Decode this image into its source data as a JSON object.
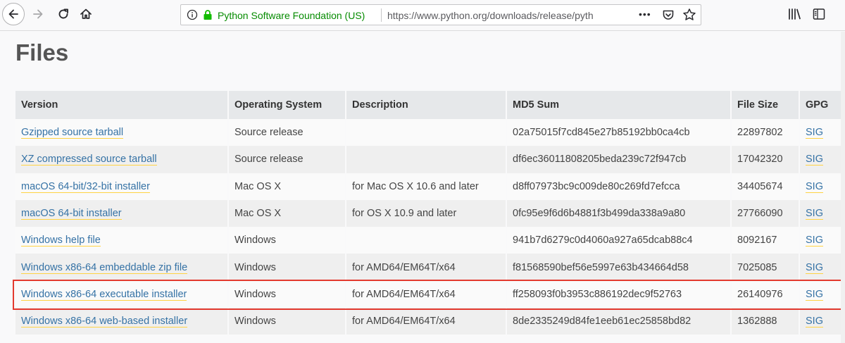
{
  "browser": {
    "site_identity": "Python Software Foundation (US)",
    "url": "https://www.python.org/downloads/release/pyth",
    "more_actions": "•••",
    "colors": {
      "secure_green": "#058b00",
      "url_gray": "#5a5a5e"
    }
  },
  "page": {
    "title": "Files",
    "table": {
      "headers": [
        "Version",
        "Operating System",
        "Description",
        "MD5 Sum",
        "File Size",
        "GPG"
      ],
      "rows": [
        {
          "version": "Gzipped source tarball",
          "os": "Source release",
          "description": "",
          "md5": "02a75015f7cd845e27b85192bb0ca4cb",
          "size": "22897802",
          "gpg": "SIG"
        },
        {
          "version": "XZ compressed source tarball",
          "os": "Source release",
          "description": "",
          "md5": "df6ec36011808205beda239c72f947cb",
          "size": "17042320",
          "gpg": "SIG"
        },
        {
          "version": "macOS 64-bit/32-bit installer",
          "os": "Mac OS X",
          "description": "for Mac OS X 10.6 and later",
          "md5": "d8ff07973bc9c009de80c269fd7efcca",
          "size": "34405674",
          "gpg": "SIG"
        },
        {
          "version": "macOS 64-bit installer",
          "os": "Mac OS X",
          "description": "for OS X 10.9 and later",
          "md5": "0fc95e9f6d6b4881f3b499da338a9a80",
          "size": "27766090",
          "gpg": "SIG"
        },
        {
          "version": "Windows help file",
          "os": "Windows",
          "description": "",
          "md5": "941b7d6279c0d4060a927a65dcab88c4",
          "size": "8092167",
          "gpg": "SIG"
        },
        {
          "version": "Windows x86-64 embeddable zip file",
          "os": "Windows",
          "description": "for AMD64/EM64T/x64",
          "md5": "f81568590bef56e5997e63b434664d58",
          "size": "7025085",
          "gpg": "SIG"
        },
        {
          "version": "Windows x86-64 executable installer",
          "os": "Windows",
          "description": "for AMD64/EM64T/x64",
          "md5": "ff258093f0b3953c886192dec9f52763",
          "size": "26140976",
          "gpg": "SIG"
        },
        {
          "version": "Windows x86-64 web-based installer",
          "os": "Windows",
          "description": "for AMD64/EM64T/x64",
          "md5": "8de2335249d84fe1eeb61ec25858bd82",
          "size": "1362888",
          "gpg": "SIG"
        }
      ]
    },
    "colors": {
      "link": "#3572a5",
      "link_underline": "#ffd343",
      "highlight": "#e33a2f",
      "header_bg": "#e6e8ea"
    }
  }
}
